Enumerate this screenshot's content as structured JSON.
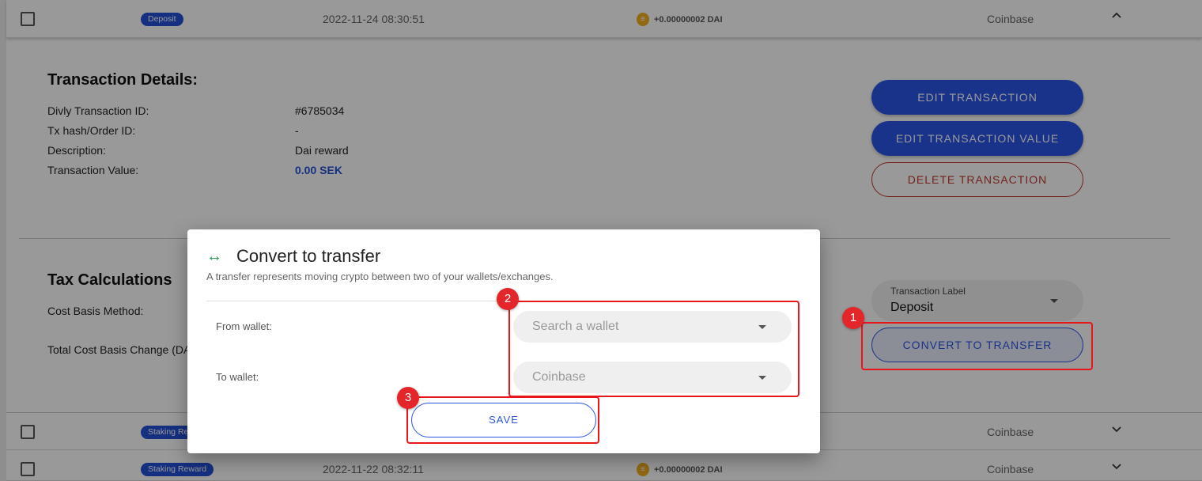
{
  "rows": [
    {
      "badge": "Deposit",
      "date": "2022-11-24 08:30:51",
      "coin_icon": "dai-coin-icon",
      "amount": "+0.00000002 DAI",
      "wallet": "Coinbase",
      "expanded": true
    },
    {
      "badge": "Staking Reward",
      "date": "",
      "coin_icon": "dai-coin-icon",
      "amount": "",
      "wallet": "Coinbase",
      "expanded": false
    },
    {
      "badge": "Staking Reward",
      "date": "2022-11-22 08:32:11",
      "coin_icon": "dai-coin-icon",
      "amount": "+0.00000002 DAI",
      "wallet": "Coinbase",
      "expanded": false
    }
  ],
  "details": {
    "title": "Transaction Details:",
    "fields": [
      {
        "label": "Divly Transaction ID:",
        "value": "#6785034"
      },
      {
        "label": "Tx hash/Order ID:",
        "value": "-"
      },
      {
        "label": "Description:",
        "value": "Dai reward"
      },
      {
        "label": "Transaction Value:",
        "value": "0.00 SEK"
      }
    ]
  },
  "tax": {
    "title": "Tax Calculations",
    "fields": [
      {
        "label": "Cost Basis Method:"
      },
      {
        "label": "Total Cost Basis Change (DAI)"
      }
    ]
  },
  "actions": {
    "edit_transaction": "EDIT TRANSACTION",
    "edit_value": "EDIT TRANSACTION VALUE",
    "delete": "DELETE TRANSACTION",
    "label_select_caption": "Transaction Label",
    "label_select_value": "Deposit",
    "convert": "CONVERT TO TRANSFER"
  },
  "modal": {
    "icon": "left-right-arrow-icon",
    "title": "Convert to transfer",
    "subtitle": "A transfer represents moving crypto between two of your wallets/exchanges.",
    "from_label": "From wallet:",
    "from_placeholder": "Search a wallet",
    "to_label": "To wallet:",
    "to_value": "Coinbase",
    "save": "SAVE"
  },
  "annotations": [
    "1",
    "2",
    "3"
  ],
  "colors": {
    "accent_blue": "#2b55e6",
    "danger_red": "#c0392b",
    "transfer_green": "#1a9e5a",
    "annotation_red": "#e4262b"
  }
}
